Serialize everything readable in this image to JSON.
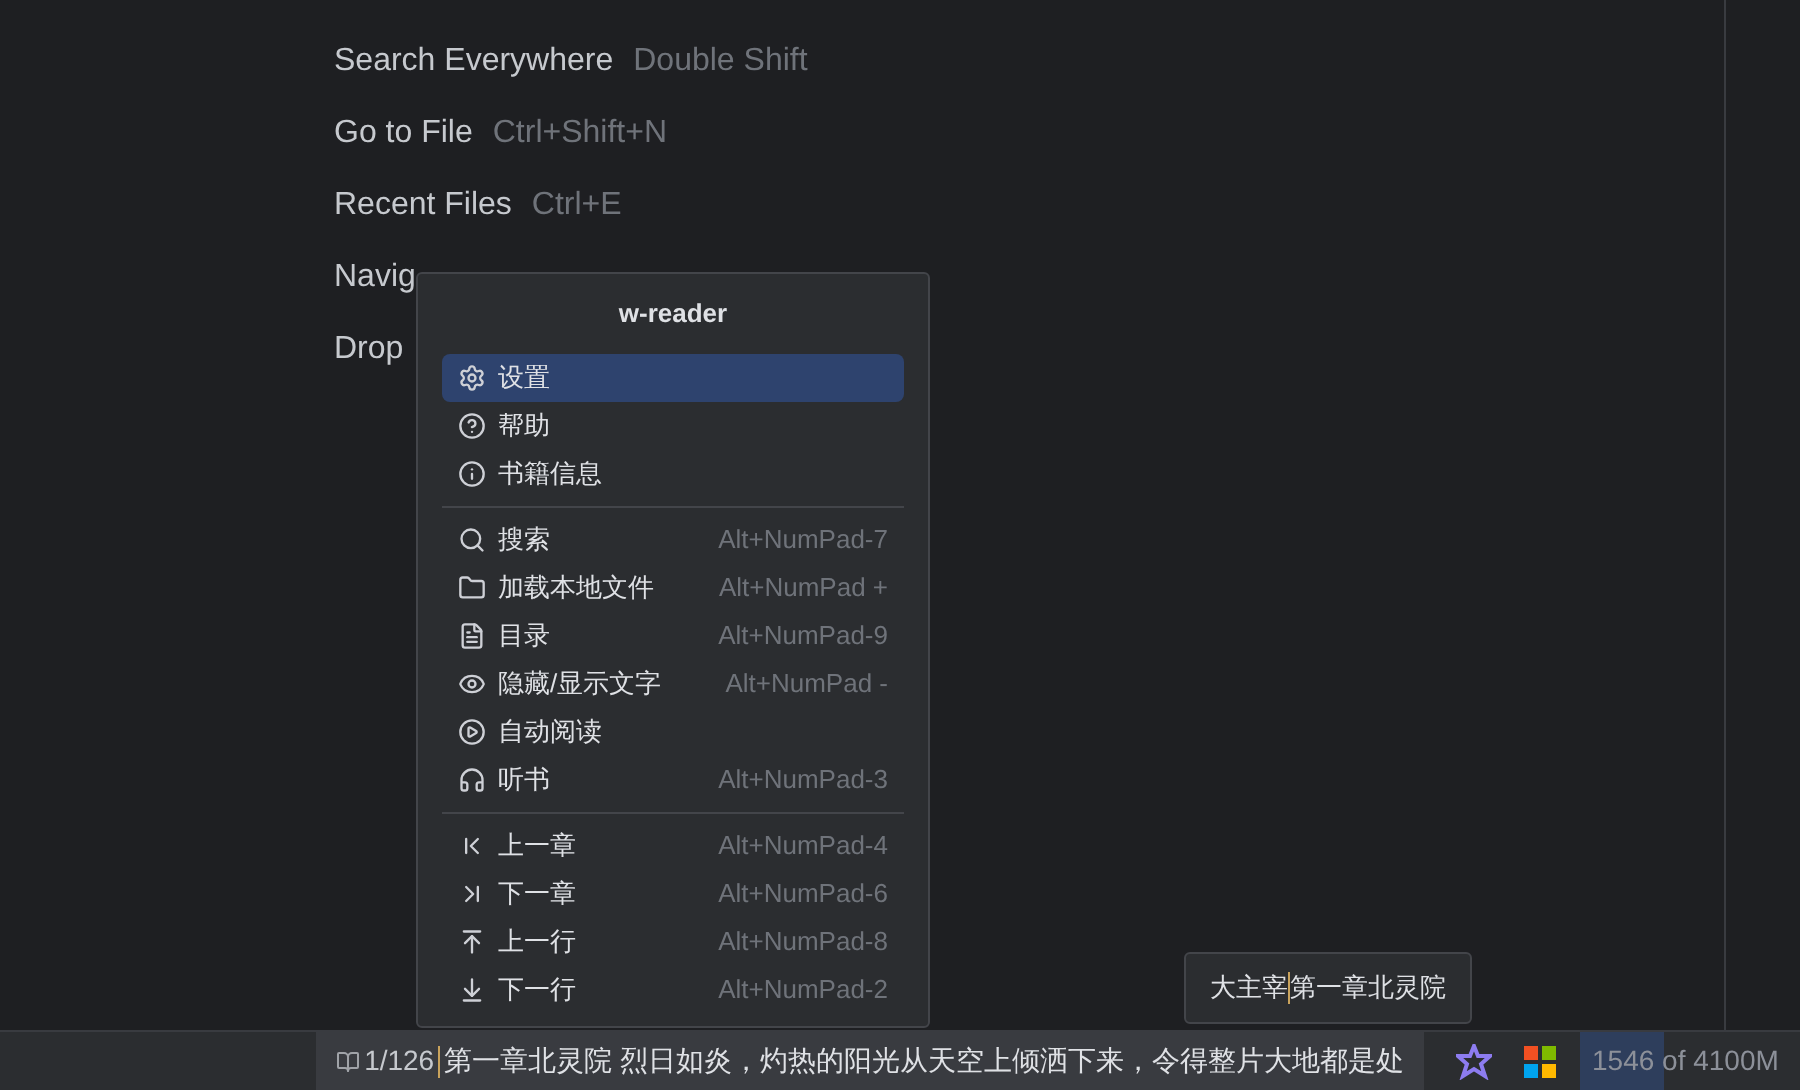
{
  "hints": [
    {
      "label": "Search Everywhere",
      "shortcut": "Double Shift"
    },
    {
      "label": "Go to File",
      "shortcut": "Ctrl+Shift+N"
    },
    {
      "label": "Recent Files",
      "shortcut": "Ctrl+E"
    },
    {
      "label": "Navig"
    },
    {
      "label": "Drop"
    }
  ],
  "popup": {
    "title": "w-reader",
    "groups": [
      [
        {
          "label": "设置",
          "selected": true
        },
        {
          "label": "帮助",
          "selected": false
        },
        {
          "label": "书籍信息",
          "selected": false
        }
      ],
      [
        {
          "label": "搜索",
          "shortcut": "Alt+NumPad-7",
          "selected": false
        },
        {
          "label": "加载本地文件",
          "shortcut": "Alt+NumPad +",
          "selected": false
        },
        {
          "label": "目录",
          "shortcut": "Alt+NumPad-9",
          "selected": false
        },
        {
          "label": "隐藏/显示文字",
          "shortcut": "Alt+NumPad -",
          "selected": false
        },
        {
          "label": "自动阅读",
          "selected": false
        },
        {
          "label": "听书",
          "shortcut": "Alt+NumPad-3",
          "selected": false
        }
      ],
      [
        {
          "label": "上一章",
          "shortcut": "Alt+NumPad-4",
          "selected": false
        },
        {
          "label": "下一章",
          "shortcut": "Alt+NumPad-6",
          "selected": false
        },
        {
          "label": "上一行",
          "shortcut": "Alt+NumPad-8",
          "selected": false
        },
        {
          "label": "下一行",
          "shortcut": "Alt+NumPad-2",
          "selected": false
        }
      ]
    ]
  },
  "tooltip": {
    "book": "大主宰",
    "chapter": "第一章北灵院"
  },
  "status_bar": {
    "page": "1/126",
    "text": "第一章北灵院 烈日如炎，灼热的阳光从天空上倾洒下来，令得整片大地都是处",
    "memory": {
      "used": "1546",
      "rest": " of 4100M",
      "level": 0.38
    }
  }
}
